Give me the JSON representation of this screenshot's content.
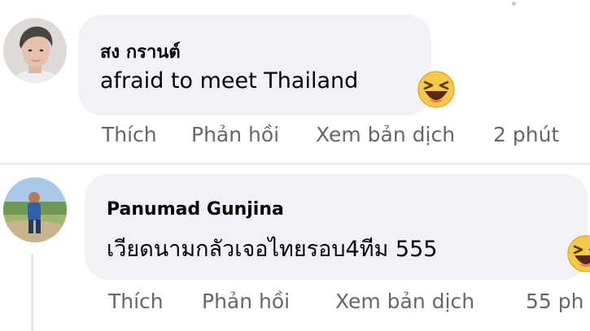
{
  "comments": [
    {
      "author": "สง กรานต์",
      "text": "afraid to meet Thailand",
      "emoji_icon": "laughing-face-emoji",
      "actions": {
        "like": "Thích",
        "reply": "Phản hồi",
        "translate": "Xem bản dịch",
        "time": "2 phút"
      }
    },
    {
      "author": "Panumad Gunjina",
      "text": "เวียดนามกลัวเจอไทยรอบ4ทีม 555",
      "emoji_icon": "laughing-face-emoji",
      "actions": {
        "like": "Thích",
        "reply": "Phản hồi",
        "translate": "Xem bản dịch",
        "time": "55 ph"
      }
    }
  ],
  "colors": {
    "bubble": "#f0f2f5",
    "action_text": "#65676b",
    "name_text": "#050505"
  }
}
